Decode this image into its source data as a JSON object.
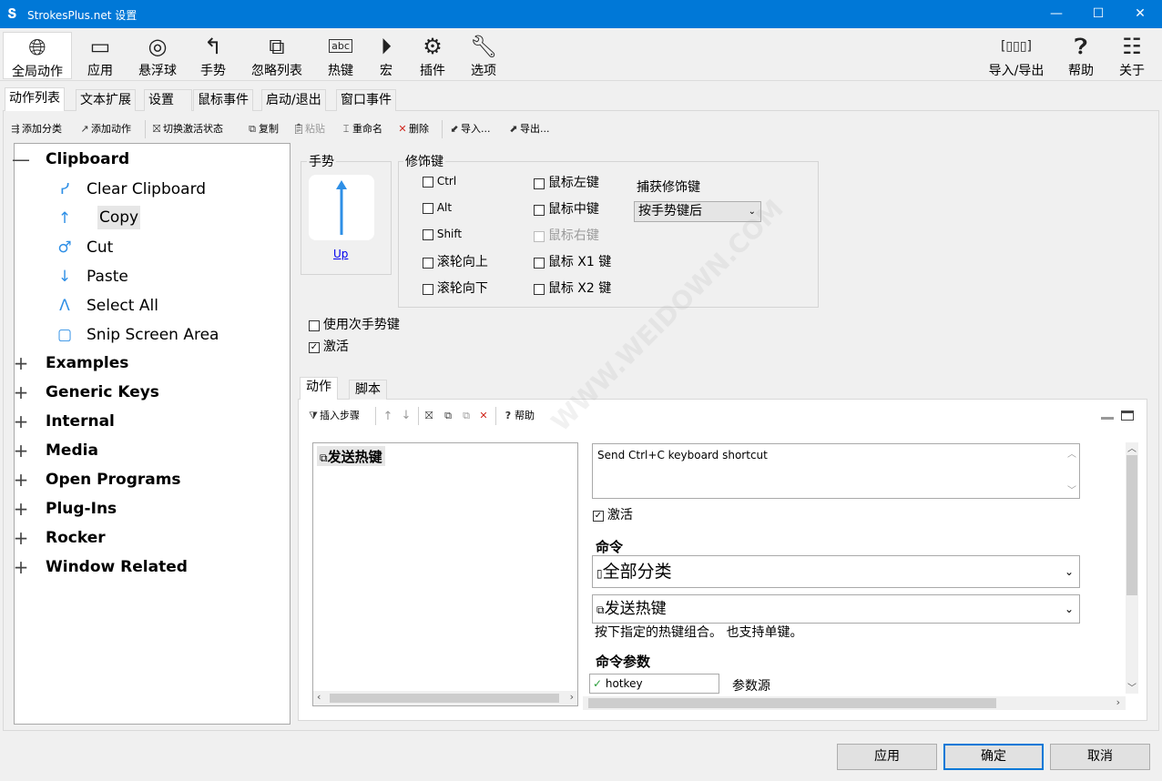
{
  "window": {
    "title": "StrokesPlus.net 设置",
    "minimize_glyph": "—",
    "maximize_glyph": "☐",
    "close_glyph": "✕"
  },
  "main_toolbar": [
    {
      "label": "全局动作",
      "icon": "globe-icon"
    },
    {
      "label": "应用",
      "icon": "window-icon"
    },
    {
      "label": "悬浮球",
      "icon": "ring-icon"
    },
    {
      "label": "手势",
      "icon": "gesture-icon"
    },
    {
      "label": "忽略列表",
      "icon": "ignore-list-icon"
    },
    {
      "label": "热键",
      "icon": "hotkey-icon"
    },
    {
      "label": "宏",
      "icon": "macro-icon"
    },
    {
      "label": "插件",
      "icon": "plugin-icon"
    },
    {
      "label": "选项",
      "icon": "wrench-icon"
    }
  ],
  "right_toolbar": [
    {
      "label": "导入/导出",
      "icon": "import-export-icon"
    },
    {
      "label": "帮助",
      "icon": "help-icon"
    },
    {
      "label": "关于",
      "icon": "about-icon"
    }
  ],
  "main_tabs": [
    "动作列表",
    "文本扩展",
    "设置",
    "鼠标事件",
    "启动/退出",
    "窗口事件"
  ],
  "sub_toolbar": {
    "add_category": "添加分类",
    "add_action": "添加动作",
    "toggle_active": "切换激活状态",
    "copy": "复制",
    "paste": "粘贴",
    "rename": "重命名",
    "delete": "删除",
    "import": "导入...",
    "export": "导出..."
  },
  "tree": {
    "expanded_category": "Clipboard",
    "leaves": [
      "Clear Clipboard",
      "Copy",
      "Cut",
      "Paste",
      "Select All",
      "Snip Screen Area"
    ],
    "categories": [
      "Examples",
      "Generic Keys",
      "Internal",
      "Media",
      "Open Programs",
      "Plug-Ins",
      "Rocker",
      "Window Related"
    ]
  },
  "gesture": {
    "group_title": "手势",
    "name": "Up"
  },
  "modifiers": {
    "group_title": "修饰键",
    "left": [
      {
        "label": "Ctrl",
        "checked": false,
        "small": true
      },
      {
        "label": "Alt",
        "checked": false,
        "small": true
      },
      {
        "label": "Shift",
        "checked": false,
        "small": true
      },
      {
        "label": "滚轮向上",
        "checked": false
      },
      {
        "label": "滚轮向下",
        "checked": false
      }
    ],
    "right": [
      {
        "label": "鼠标左键",
        "checked": false
      },
      {
        "label": "鼠标中键",
        "checked": false
      },
      {
        "label": "鼠标右键",
        "checked": false,
        "disabled": true
      },
      {
        "label": "鼠标 X1 键",
        "checked": false
      },
      {
        "label": "鼠标 X2 键",
        "checked": false
      }
    ],
    "capture_label": "捕获修饰键",
    "capture_value": "按手势键后"
  },
  "options": {
    "secondary_gesture": "使用次手势键",
    "active": "激活"
  },
  "inner_tabs": [
    "动作",
    "脚本"
  ],
  "action_toolbar": {
    "insert_step": "插入步骤",
    "help": "帮助"
  },
  "steps": [
    "发送热键"
  ],
  "step_detail": {
    "description": "Send Ctrl+C keyboard shortcut",
    "active": "激活",
    "command_label": "命令",
    "category_value": "全部分类",
    "command_value": "发送热键",
    "command_help": "按下指定的热键组合。 也支持单键。",
    "params_label": "命令参数",
    "param_name": "hotkey",
    "param_source": "参数源"
  },
  "footer": {
    "apply": "应用",
    "ok": "确定",
    "cancel": "取消"
  },
  "watermark": "WWW.WEIDOWN.COM"
}
